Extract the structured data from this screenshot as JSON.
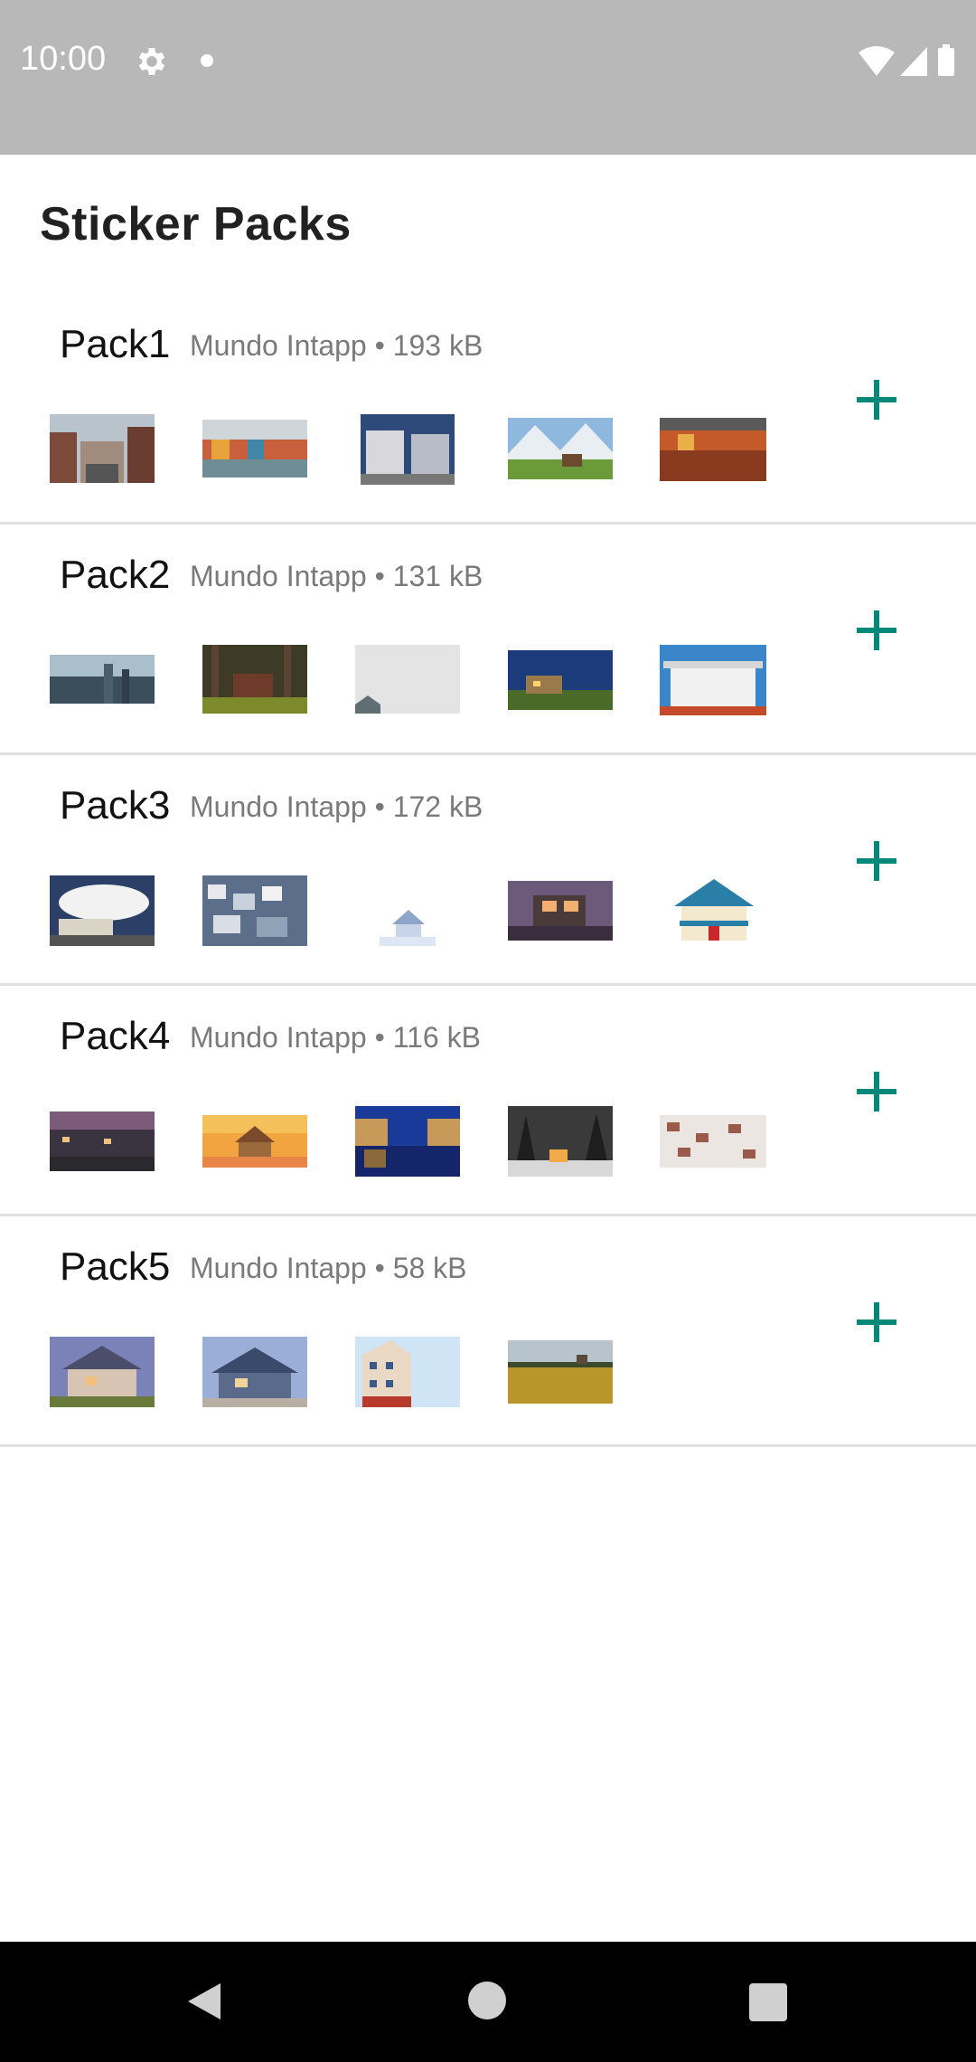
{
  "status_bar": {
    "time": "10:00",
    "icons": [
      "gear-icon",
      "notification-dot-icon",
      "wifi-icon",
      "signal-icon",
      "battery-icon"
    ]
  },
  "page": {
    "title": "Sticker Packs",
    "accent_color": "#00897b"
  },
  "packs": [
    {
      "name": "Pack1",
      "publisher": "Mundo Intapp",
      "separator": "•",
      "size": "193 kB",
      "thumbnails": [
        "city-street",
        "colorful-harbor-houses",
        "victorian-houses",
        "mountain-valley-house",
        "autumn-lake-houses"
      ]
    },
    {
      "name": "Pack2",
      "publisher": "Mundo Intapp",
      "separator": "•",
      "size": "131 kB",
      "thumbnails": [
        "city-skyline",
        "forest-cabin",
        "foggy-roof",
        "blue-night-house",
        "white-mansion"
      ]
    },
    {
      "name": "Pack3",
      "publisher": "Mundo Intapp",
      "separator": "•",
      "size": "172 kB",
      "thumbnails": [
        "cloudy-farmhouse",
        "hillside-town",
        "snow-cottage",
        "modern-lit-house",
        "blue-roof-house"
      ]
    },
    {
      "name": "Pack4",
      "publisher": "Mundo Intapp",
      "separator": "•",
      "size": "116 kB",
      "thumbnails": [
        "dusk-street",
        "sunset-hut",
        "canal-night",
        "snowy-forest-cabin",
        "white-rooftops"
      ]
    },
    {
      "name": "Pack5",
      "publisher": "Mundo Intapp",
      "separator": "•",
      "size": "58 kB",
      "thumbnails": [
        "suburban-house-dusk",
        "blue-suburban-house",
        "corner-building",
        "wheat-field"
      ]
    }
  ],
  "nav_bar": {
    "icons": [
      "back-icon",
      "home-icon",
      "recents-icon"
    ]
  }
}
